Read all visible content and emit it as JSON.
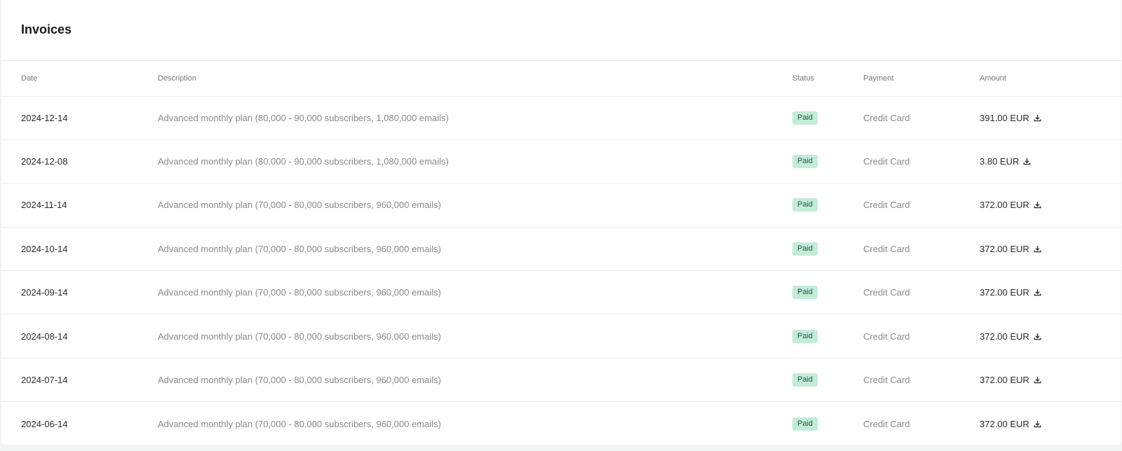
{
  "header": {
    "title": "Invoices"
  },
  "table": {
    "columns": {
      "date": "Date",
      "description": "Description",
      "status": "Status",
      "payment": "Payment",
      "amount": "Amount"
    },
    "rows": [
      {
        "date": "2024-12-14",
        "description": "Advanced monthly plan (80,000 - 90,000 subscribers, 1,080,000 emails)",
        "status": "Paid",
        "payment": "Credit Card",
        "amount": "391.00 EUR"
      },
      {
        "date": "2024-12-08",
        "description": "Advanced monthly plan (80,000 - 90,000 subscribers, 1,080,000 emails)",
        "status": "Paid",
        "payment": "Credit Card",
        "amount": "3.80 EUR"
      },
      {
        "date": "2024-11-14",
        "description": "Advanced monthly plan (70,000 - 80,000 subscribers, 960,000 emails)",
        "status": "Paid",
        "payment": "Credit Card",
        "amount": "372.00 EUR"
      },
      {
        "date": "2024-10-14",
        "description": "Advanced monthly plan (70,000 - 80,000 subscribers, 960,000 emails)",
        "status": "Paid",
        "payment": "Credit Card",
        "amount": "372.00 EUR"
      },
      {
        "date": "2024-09-14",
        "description": "Advanced monthly plan (70,000 - 80,000 subscribers, 960,000 emails)",
        "status": "Paid",
        "payment": "Credit Card",
        "amount": "372.00 EUR"
      },
      {
        "date": "2024-08-14",
        "description": "Advanced monthly plan (70,000 - 80,000 subscribers, 960,000 emails)",
        "status": "Paid",
        "payment": "Credit Card",
        "amount": "372.00 EUR"
      },
      {
        "date": "2024-07-14",
        "description": "Advanced monthly plan (70,000 - 80,000 subscribers, 960,000 emails)",
        "status": "Paid",
        "payment": "Credit Card",
        "amount": "372.00 EUR"
      },
      {
        "date": "2024-06-14",
        "description": "Advanced monthly plan (70,000 - 80,000 subscribers, 960,000 emails)",
        "status": "Paid",
        "payment": "Credit Card",
        "amount": "372.00 EUR"
      }
    ]
  },
  "icons": {
    "amount_action": "download-icon"
  },
  "colors": {
    "paid_badge_bg": "#c3ecd8",
    "paid_badge_text": "#1f5a3e"
  }
}
